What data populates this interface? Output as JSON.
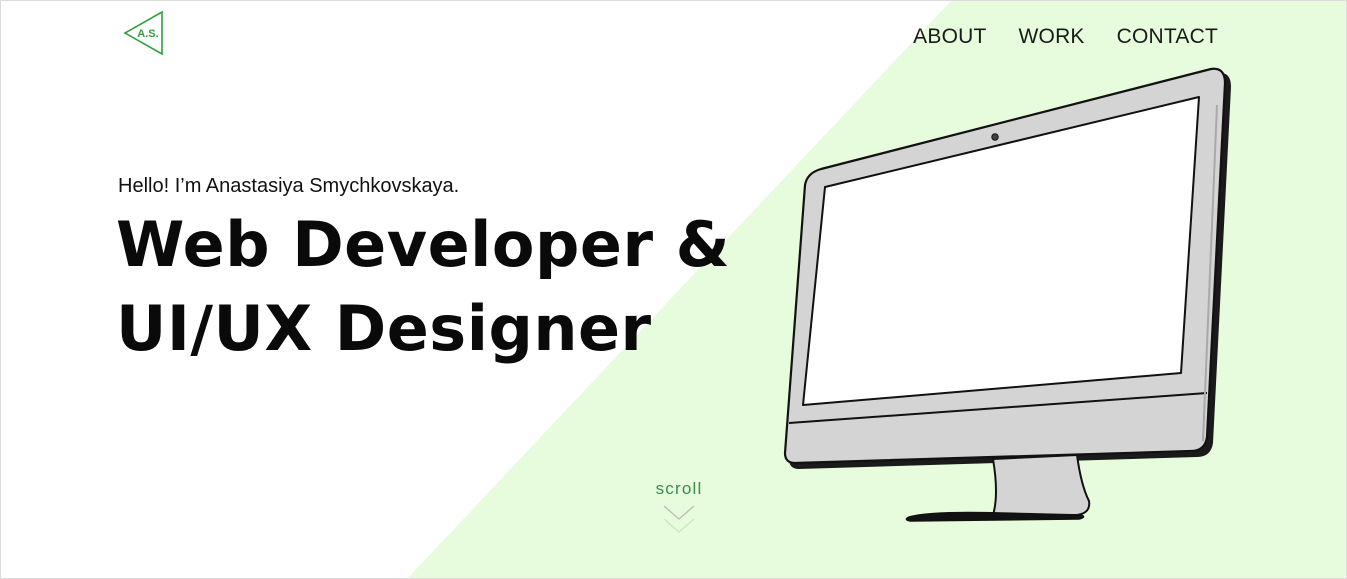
{
  "brand": {
    "logo_text": "A.S.",
    "accent_color": "#2e9e3e",
    "background_tint": "#e6fcdc"
  },
  "nav": {
    "items": [
      {
        "label": "ABOUT"
      },
      {
        "label": "WORK"
      },
      {
        "label": "CONTACT"
      }
    ]
  },
  "hero": {
    "greeting": "Hello! I’m Anastasiya Smychkovskaya.",
    "headline_line1": "Web Developer &",
    "headline_line2": "UI/UX Designer"
  },
  "scroll": {
    "label": "scroll",
    "icon": "chevron-down-icon"
  },
  "illustration": {
    "icon": "monitor-illustration"
  }
}
